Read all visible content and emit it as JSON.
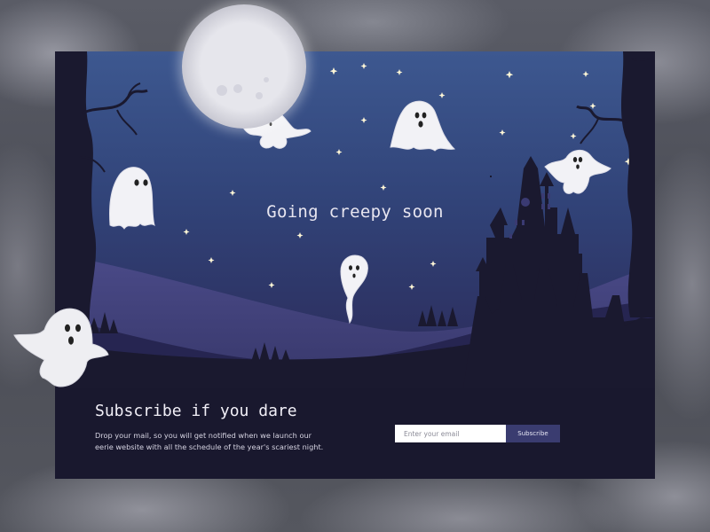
{
  "hero": {
    "headline": "Going creepy soon"
  },
  "subscribe": {
    "title": "Subscribe if you dare",
    "description": "Drop your mail, so you will get notified when we launch our eerie website with all the schedule of the year's scariest night.",
    "email_placeholder": "Enter your email",
    "button_label": "Subscribe"
  },
  "colors": {
    "sky_top": "#3c5488",
    "sky_bottom": "#2a2a58",
    "night_ground": "#19182e",
    "accent_button": "#3a3c70",
    "ghost": "#f2f2f5",
    "moon": "#e4e4ea"
  },
  "icons": [
    "moon-icon",
    "ghost-icon",
    "castle-icon",
    "tree-icon",
    "star-icon"
  ]
}
